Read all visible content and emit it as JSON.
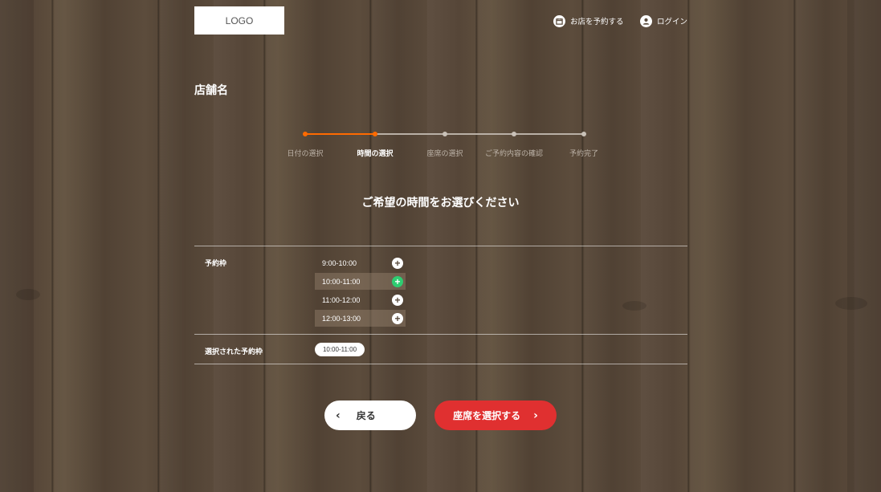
{
  "header": {
    "logo": "LOGO",
    "reserve_label": "お店を予約する",
    "login_label": "ログイン"
  },
  "store_name": "店舗名",
  "steps": [
    {
      "label": "日付の選択",
      "state": "done"
    },
    {
      "label": "時間の選択",
      "state": "active"
    },
    {
      "label": "座席の選択",
      "state": "pending"
    },
    {
      "label": "ご予約内容の確認",
      "state": "pending"
    },
    {
      "label": "予約完了",
      "state": "pending"
    }
  ],
  "headline": "ご希望の時間をお選びください",
  "slots_label": "予約枠",
  "slots": [
    {
      "time": "9:00-10:00",
      "selected": false
    },
    {
      "time": "10:00-11:00",
      "selected": true
    },
    {
      "time": "11:00-12:00",
      "selected": false
    },
    {
      "time": "12:00-13:00",
      "selected": false
    }
  ],
  "selected_label": "選択された予約枠",
  "selected_value": "10:00-11:00",
  "buttons": {
    "back": "戻る",
    "next": "座席を選択する"
  },
  "colors": {
    "accent": "#ff6a00",
    "primary_button": "#e03030",
    "selected_plus": "#2ecc71"
  }
}
